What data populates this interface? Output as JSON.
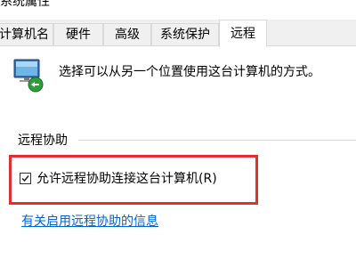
{
  "window": {
    "title": "系统属性"
  },
  "tabs": [
    {
      "label": "计算机名",
      "active": false
    },
    {
      "label": "硬件",
      "active": false
    },
    {
      "label": "高级",
      "active": false
    },
    {
      "label": "系统保护",
      "active": false
    },
    {
      "label": "远程",
      "active": true
    }
  ],
  "remote": {
    "icon": "remote-computer-icon",
    "description": "选择可以从另一个位置使用这台计算机的方式。",
    "assistance_group_title": "远程协助",
    "allow_assistance_label": "允许远程协助连接这台计算机(R)",
    "allow_assistance_checked": true,
    "info_link": "有关启用远程协助的信息"
  },
  "colors": {
    "highlight": "#e0312e",
    "link": "#0066cc",
    "tab_background": "#f0f0f0"
  }
}
